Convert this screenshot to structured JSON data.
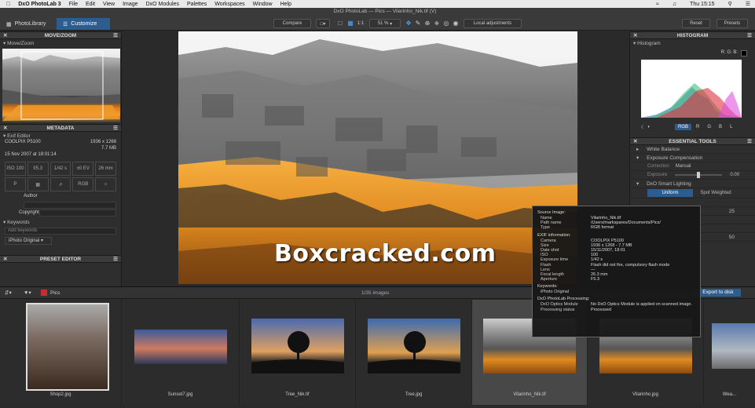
{
  "menubar": {
    "app": "DxO PhotoLab 3",
    "items": [
      "File",
      "Edit",
      "View",
      "Image",
      "DxO Modules",
      "Palettes",
      "Workspaces",
      "Window",
      "Help"
    ],
    "clock": "Thu 15:15"
  },
  "window_title": "DxO PhotoLab — Pics — Vilarinho_Nik.tif (V)",
  "toolbar": {
    "tab_library": "PhotoLibrary",
    "tab_customize": "Customize",
    "compare": "Compare",
    "zoom_fit": "1:1",
    "zoom": "51 %",
    "local_adjustments": "Local adjustments",
    "reset": "Reset",
    "presets": "Presets"
  },
  "left": {
    "move_zoom_header": "MOVE/ZOOM",
    "move_zoom_sub": "Move/Zoom",
    "metadata_header": "METADATA",
    "exif_editor": "Exif Editor",
    "camera": "COOLPIX P5100",
    "dimensions": "1936 x 1268",
    "filesize": "7.7 MB",
    "date": "15 Nov 2007 at 18:01:14",
    "exif": [
      "ISO 100",
      "f/5.3",
      "1/42 s",
      "±0 EV",
      "26 mm",
      "P",
      "",
      "",
      "RGB",
      ""
    ],
    "author_label": "Author",
    "copyright_label": "Copyright",
    "keywords_label": "Keywords",
    "add_keywords": "Add keywords",
    "iphoto": "iPhoto Original",
    "preset_editor_header": "PRESET EDITOR"
  },
  "right": {
    "histogram_header": "HISTOGRAM",
    "histogram_sub": "Histogram",
    "rgb_readout": "R: G: B:",
    "channels": [
      "RGB",
      "R",
      "G",
      "B",
      "L"
    ],
    "essential_tools_header": "ESSENTIAL TOOLS",
    "white_balance": "White Balance",
    "exposure_comp": "Exposure Compensation",
    "correction_label": "Correction",
    "correction_value": "Manual",
    "exposure_label": "Exposure",
    "exposure_value": "0.00",
    "smart_lighting": "DxO Smart Lighting",
    "uniform": "Uniform",
    "spot_weighted": "Spot Weighted",
    "val1": "25",
    "val2": "50"
  },
  "filmstrip": {
    "folder": "Pics",
    "count": "1/35 images",
    "export": "Export to disk",
    "thumbs": [
      "Shop2.jpg",
      "Sunset7.jpg",
      "Tree_Nik.tif",
      "Tree.jpg",
      "Vilarinho_Nik.tif",
      "Vilarinho.jpg",
      "Wea..."
    ]
  },
  "tooltip": {
    "source_header": "Source Image:",
    "rows1": [
      [
        "Name",
        "Vilarinho_Nik.tif"
      ],
      [
        "Path name",
        "/Users/markspares/Documents/Pics/"
      ],
      [
        "Type",
        "RGB format"
      ]
    ],
    "exif_header": "EXIF information:",
    "rows2": [
      [
        "Camera",
        "COOLPIX P5100"
      ],
      [
        "Size",
        "1936 x 1268 - 7.7 MB"
      ],
      [
        "Date shot",
        "15/11/2007, 18:01"
      ],
      [
        "ISO",
        "100"
      ],
      [
        "Exposure time",
        "1/42 s"
      ],
      [
        "Flash",
        "Flash did not fire, compulsory flash mode"
      ],
      [
        "Lens",
        "—"
      ],
      [
        "Focal length",
        "26.3 mm"
      ],
      [
        "Aperture",
        "F5.3"
      ]
    ],
    "keywords_header": "Keywords:",
    "keywords_value": "iPhoto Original",
    "processing_header": "DxO PhotoLab Processing:",
    "rows3": [
      [
        "DxO Optics Module",
        "No DxO Optics Module is applied on scanned image."
      ],
      [
        "Processing status",
        "Processed"
      ]
    ]
  },
  "watermark": "Boxcracked.com"
}
